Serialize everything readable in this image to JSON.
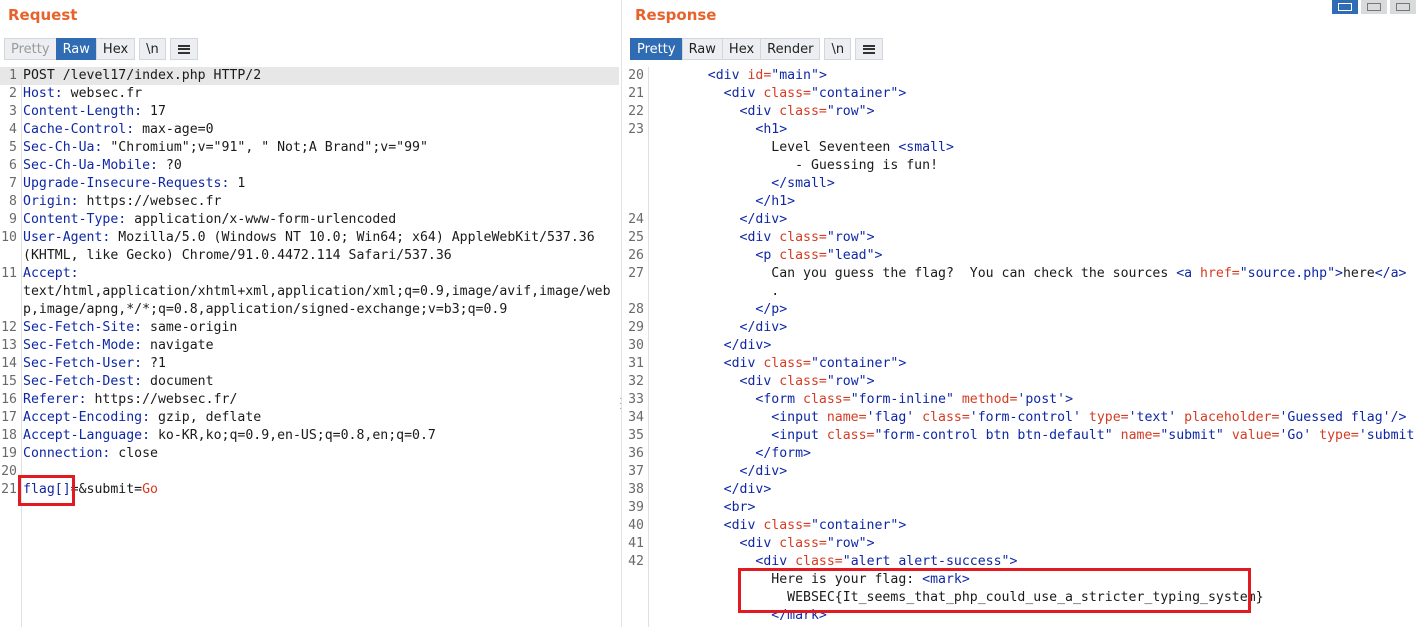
{
  "request": {
    "title": "Request",
    "tabs": {
      "pretty": "Pretty",
      "raw": "Raw",
      "hex": "Hex",
      "newline": "\\n"
    },
    "lines": [
      {
        "n": "1",
        "h": "",
        "v": "POST /level17/index.php HTTP/2"
      },
      {
        "n": "2",
        "h": "Host:",
        "v": " websec.fr"
      },
      {
        "n": "3",
        "h": "Content-Length:",
        "v": " 17"
      },
      {
        "n": "4",
        "h": "Cache-Control:",
        "v": " max-age=0"
      },
      {
        "n": "5",
        "h": "Sec-Ch-Ua:",
        "v": " \"Chromium\";v=\"91\", \" Not;A Brand\";v=\"99\""
      },
      {
        "n": "6",
        "h": "Sec-Ch-Ua-Mobile:",
        "v": " ?0"
      },
      {
        "n": "7",
        "h": "Upgrade-Insecure-Requests:",
        "v": " 1"
      },
      {
        "n": "8",
        "h": "Origin:",
        "v": " https://websec.fr"
      },
      {
        "n": "9",
        "h": "Content-Type:",
        "v": " application/x-www-form-urlencoded"
      },
      {
        "n": "10",
        "h": "User-Agent:",
        "v": " Mozilla/5.0 (Windows NT 10.0; Win64; x64) AppleWebKit/537.36"
      },
      {
        "n": "",
        "h": "",
        "v": "(KHTML, like Gecko) Chrome/91.0.4472.114 Safari/537.36"
      },
      {
        "n": "11",
        "h": "Accept:",
        "v": ""
      },
      {
        "n": "",
        "h": "",
        "v": "text/html,application/xhtml+xml,application/xml;q=0.9,image/avif,image/web"
      },
      {
        "n": "",
        "h": "",
        "v": "p,image/apng,*/*;q=0.8,application/signed-exchange;v=b3;q=0.9"
      },
      {
        "n": "12",
        "h": "Sec-Fetch-Site:",
        "v": " same-origin"
      },
      {
        "n": "13",
        "h": "Sec-Fetch-Mode:",
        "v": " navigate"
      },
      {
        "n": "14",
        "h": "Sec-Fetch-User:",
        "v": " ?1"
      },
      {
        "n": "15",
        "h": "Sec-Fetch-Dest:",
        "v": " document"
      },
      {
        "n": "16",
        "h": "Referer:",
        "v": " https://websec.fr/"
      },
      {
        "n": "17",
        "h": "Accept-Encoding:",
        "v": " gzip, deflate"
      },
      {
        "n": "18",
        "h": "Accept-Language:",
        "v": " ko-KR,ko;q=0.9,en-US;q=0.8,en;q=0.7"
      },
      {
        "n": "19",
        "h": "Connection:",
        "v": " close"
      },
      {
        "n": "20",
        "h": "",
        "v": ""
      }
    ],
    "body_line": {
      "n": "21",
      "p1": "flag[]",
      "p2": "=&submit=",
      "p3": "Go"
    }
  },
  "response": {
    "title": "Response",
    "tabs": {
      "pretty": "Pretty",
      "raw": "Raw",
      "hex": "Hex",
      "render": "Render",
      "newline": "\\n"
    },
    "lines": [
      {
        "n": "20",
        "i": "    ",
        "parts": [
          [
            "tag",
            "<div "
          ],
          [
            "attr",
            "id="
          ],
          [
            "str",
            "\"main\""
          ],
          [
            "tag",
            ">"
          ]
        ]
      },
      {
        "n": "21",
        "i": "      ",
        "parts": [
          [
            "tag",
            "<div "
          ],
          [
            "attr",
            "class="
          ],
          [
            "str",
            "\"container\""
          ],
          [
            "tag",
            ">"
          ]
        ]
      },
      {
        "n": "22",
        "i": "        ",
        "parts": [
          [
            "tag",
            "<div "
          ],
          [
            "attr",
            "class="
          ],
          [
            "str",
            "\"row\""
          ],
          [
            "tag",
            ">"
          ]
        ]
      },
      {
        "n": "23",
        "i": "          ",
        "parts": [
          [
            "tag",
            "<h1>"
          ]
        ]
      },
      {
        "n": "",
        "i": "            ",
        "parts": [
          [
            "val",
            "Level Seventeen "
          ],
          [
            "tag",
            "<small>"
          ]
        ]
      },
      {
        "n": "",
        "i": "               ",
        "parts": [
          [
            "val",
            "- Guessing is fun!"
          ]
        ]
      },
      {
        "n": "",
        "i": "            ",
        "parts": [
          [
            "tag",
            "</small>"
          ]
        ]
      },
      {
        "n": "",
        "i": "          ",
        "parts": [
          [
            "tag",
            "</h1>"
          ]
        ]
      },
      {
        "n": "24",
        "i": "        ",
        "parts": [
          [
            "tag",
            "</div>"
          ]
        ]
      },
      {
        "n": "25",
        "i": "        ",
        "parts": [
          [
            "tag",
            "<div "
          ],
          [
            "attr",
            "class="
          ],
          [
            "str",
            "\"row\""
          ],
          [
            "tag",
            ">"
          ]
        ]
      },
      {
        "n": "26",
        "i": "          ",
        "parts": [
          [
            "tag",
            "<p "
          ],
          [
            "attr",
            "class="
          ],
          [
            "str",
            "\"lead\""
          ],
          [
            "tag",
            ">"
          ]
        ]
      },
      {
        "n": "27",
        "i": "            ",
        "parts": [
          [
            "val",
            "Can you guess the flag?  You can check the sources "
          ],
          [
            "tag",
            "<a "
          ],
          [
            "attr",
            "href="
          ],
          [
            "str",
            "\"source.php\""
          ],
          [
            "tag",
            ">"
          ],
          [
            "val",
            "here"
          ],
          [
            "tag",
            "</a>"
          ]
        ]
      },
      {
        "n": "",
        "i": "            ",
        "parts": [
          [
            "val",
            "."
          ]
        ]
      },
      {
        "n": "28",
        "i": "          ",
        "parts": [
          [
            "tag",
            "</p>"
          ]
        ]
      },
      {
        "n": "29",
        "i": "        ",
        "parts": [
          [
            "tag",
            "</div>"
          ]
        ]
      },
      {
        "n": "30",
        "i": "      ",
        "parts": [
          [
            "tag",
            "</div>"
          ]
        ]
      },
      {
        "n": "31",
        "i": "      ",
        "parts": [
          [
            "tag",
            "<div "
          ],
          [
            "attr",
            "class="
          ],
          [
            "str",
            "\"container\""
          ],
          [
            "tag",
            ">"
          ]
        ]
      },
      {
        "n": "32",
        "i": "        ",
        "parts": [
          [
            "tag",
            "<div "
          ],
          [
            "attr",
            "class="
          ],
          [
            "str",
            "\"row\""
          ],
          [
            "tag",
            ">"
          ]
        ]
      },
      {
        "n": "33",
        "i": "          ",
        "parts": [
          [
            "tag",
            "<form "
          ],
          [
            "attr",
            "class="
          ],
          [
            "str",
            "\"form-inline\" "
          ],
          [
            "attr",
            "method="
          ],
          [
            "str",
            "'post'"
          ],
          [
            "tag",
            ">"
          ]
        ]
      },
      {
        "n": "34",
        "i": "            ",
        "parts": [
          [
            "tag",
            "<input "
          ],
          [
            "attr",
            "name="
          ],
          [
            "str",
            "'flag' "
          ],
          [
            "attr",
            "class="
          ],
          [
            "str",
            "'form-control' "
          ],
          [
            "attr",
            "type="
          ],
          [
            "str",
            "'text' "
          ],
          [
            "attr",
            "placeholder="
          ],
          [
            "str",
            "'Guessed flag'"
          ],
          [
            "tag",
            "/>"
          ]
        ]
      },
      {
        "n": "35",
        "i": "            ",
        "parts": [
          [
            "tag",
            "<input "
          ],
          [
            "attr",
            "class="
          ],
          [
            "str",
            "\"form-control btn btn-default\" "
          ],
          [
            "attr",
            "name="
          ],
          [
            "str",
            "\"submit\" "
          ],
          [
            "attr",
            "value="
          ],
          [
            "str",
            "'Go' "
          ],
          [
            "attr",
            "type="
          ],
          [
            "str",
            "'submit'"
          ],
          [
            "tag",
            "/>"
          ]
        ]
      },
      {
        "n": "36",
        "i": "          ",
        "parts": [
          [
            "tag",
            "</form>"
          ]
        ]
      },
      {
        "n": "37",
        "i": "        ",
        "parts": [
          [
            "tag",
            "</div>"
          ]
        ]
      },
      {
        "n": "38",
        "i": "      ",
        "parts": [
          [
            "tag",
            "</div>"
          ]
        ]
      },
      {
        "n": "39",
        "i": "      ",
        "parts": [
          [
            "tag",
            "<br>"
          ]
        ]
      },
      {
        "n": "40",
        "i": "      ",
        "parts": [
          [
            "tag",
            "<div "
          ],
          [
            "attr",
            "class="
          ],
          [
            "str",
            "\"container\""
          ],
          [
            "tag",
            ">"
          ]
        ]
      },
      {
        "n": "41",
        "i": "        ",
        "parts": [
          [
            "tag",
            "<div "
          ],
          [
            "attr",
            "class="
          ],
          [
            "str",
            "\"row\""
          ],
          [
            "tag",
            ">"
          ]
        ]
      },
      {
        "n": "42",
        "i": "          ",
        "parts": [
          [
            "tag",
            "<div "
          ],
          [
            "attr",
            "class="
          ],
          [
            "str",
            "\"alert alert-success\""
          ],
          [
            "tag",
            ">"
          ]
        ]
      },
      {
        "n": "",
        "i": "            ",
        "parts": [
          [
            "val",
            "Here is your flag: "
          ],
          [
            "tag",
            "<mark>"
          ]
        ]
      },
      {
        "n": "",
        "i": "              ",
        "parts": [
          [
            "val",
            "WEBSEC{It_seems_that_php_could_use_a_stricter_typing_system}"
          ]
        ]
      },
      {
        "n": "",
        "i": "            ",
        "parts": [
          [
            "tag",
            "</mark>"
          ]
        ]
      }
    ]
  }
}
